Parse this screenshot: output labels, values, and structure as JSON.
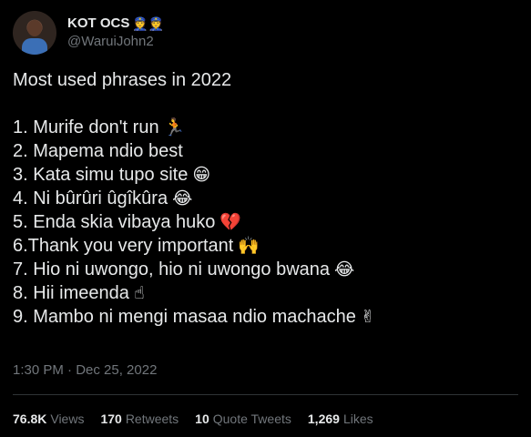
{
  "author": {
    "display_name": "KOT OCS",
    "badges": "👮👮",
    "handle": "@WaruiJohn2"
  },
  "tweet": {
    "title": "Most used phrases in 2022",
    "items": [
      {
        "text": "1. Murife don't run",
        "emoji": "🏃"
      },
      {
        "text": "2. Mapema ndio best",
        "emoji": ""
      },
      {
        "text": "3. Kata simu tupo site",
        "emoji": "😁"
      },
      {
        "text": "4. Ni bûrûri ûgîkûra",
        "emoji": "😂"
      },
      {
        "text": "5. Enda skia vibaya huko",
        "emoji": "💔"
      },
      {
        "text": "6.Thank you very important",
        "emoji": "🙌"
      },
      {
        "text": "7. Hio ni uwongo, hio ni uwongo bwana",
        "emoji": "😂"
      },
      {
        "text": "8. Hii imeenda",
        "emoji": "☝"
      },
      {
        "text": "9. Mambo ni mengi masaa ndio machache",
        "emoji": "✌"
      }
    ],
    "timestamp": "1:30 PM · Dec 25, 2022"
  },
  "stats": {
    "views": {
      "count": "76.8K",
      "label": "Views"
    },
    "retweets": {
      "count": "170",
      "label": "Retweets"
    },
    "quote_tweets": {
      "count": "10",
      "label": "Quote Tweets"
    },
    "likes": {
      "count": "1,269",
      "label": "Likes"
    }
  },
  "colors": {
    "background": "#000000",
    "primary_text": "#e7e9ea",
    "secondary_text": "#71767b",
    "divider": "#2f3336"
  }
}
